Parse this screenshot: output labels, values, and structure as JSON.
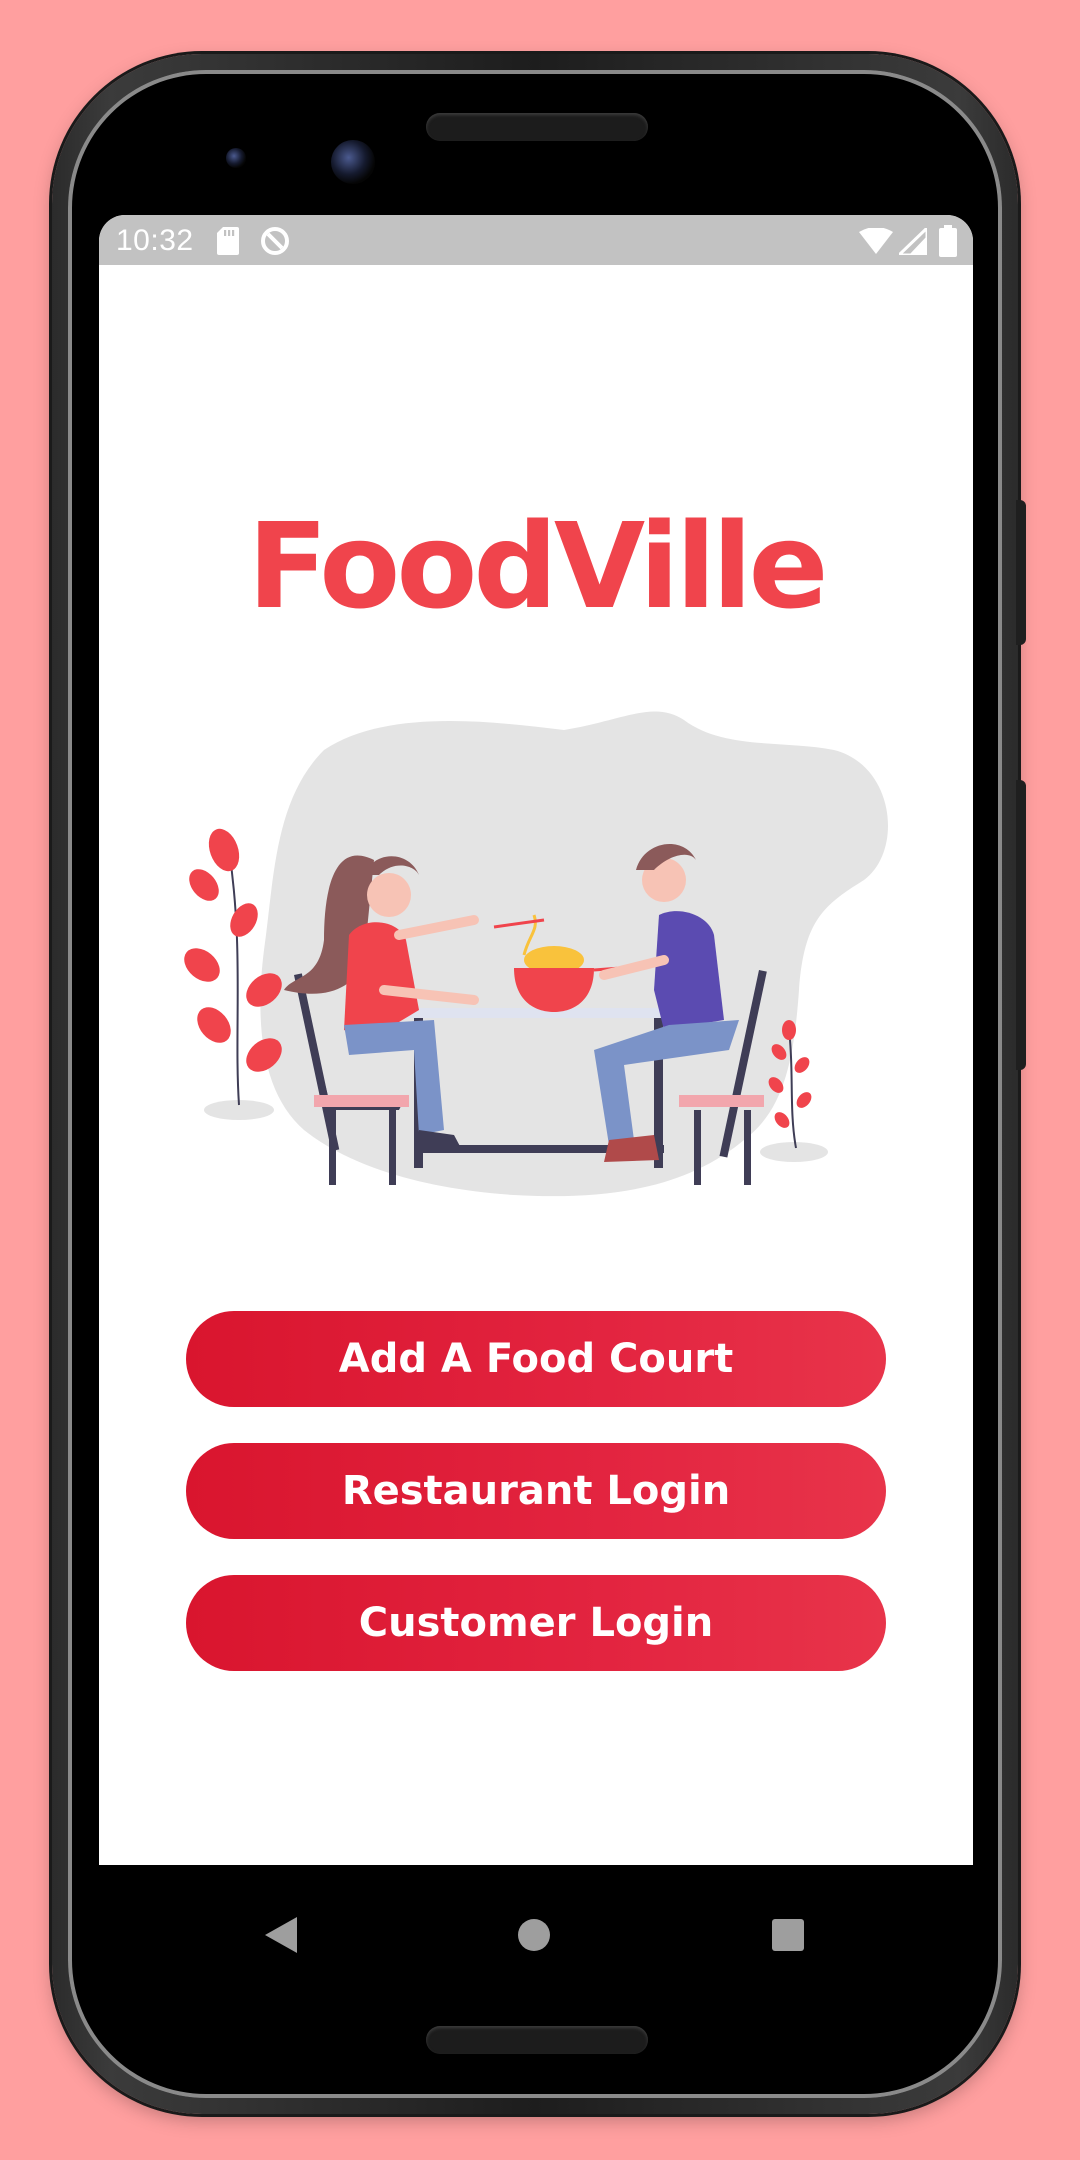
{
  "status_bar": {
    "time": "10:32",
    "icons": [
      "sd-card-icon",
      "sync-icon",
      "wifi-icon",
      "cell-signal-icon",
      "battery-icon"
    ]
  },
  "app": {
    "title": "FoodVille",
    "title_color": "#f0444c",
    "accent_color": "#dc1a32",
    "illustration": "couple-eating-noodles-illustration"
  },
  "buttons": {
    "add_food_court": "Add A Food Court",
    "restaurant_login": "Restaurant Login",
    "customer_login": "Customer Login"
  },
  "nav_bar": {
    "icons": [
      "back-icon",
      "home-icon",
      "recents-icon"
    ]
  },
  "device": {
    "background_color": "#ff9f9f"
  }
}
